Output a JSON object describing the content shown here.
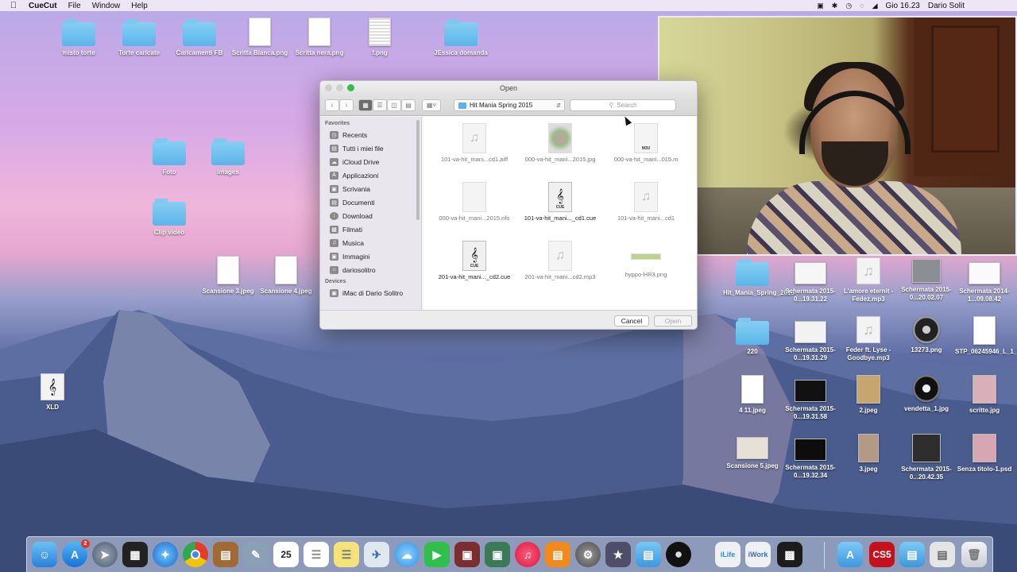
{
  "menubar": {
    "app_name": "CueCut",
    "menus": [
      "File",
      "Window",
      "Help"
    ],
    "clock": "Gio 16.23",
    "user": "Dario Solit"
  },
  "desktop": {
    "items": [
      {
        "label": "misto torte",
        "type": "folder"
      },
      {
        "label": "Torte caricate",
        "type": "folder"
      },
      {
        "label": "Caricamenti FB",
        "type": "folder"
      },
      {
        "label": "Scritta Bianca.png",
        "type": "doc"
      },
      {
        "label": "Scritta nera.png",
        "type": "doc"
      },
      {
        "label": "f.png",
        "type": "doc"
      },
      {
        "label": "JEssica domanda",
        "type": "folder"
      },
      {
        "label": "Foto",
        "type": "folder"
      },
      {
        "label": "Images",
        "type": "folder"
      },
      {
        "label": "Clip video",
        "type": "folder"
      },
      {
        "label": "Scansione 3.jpeg",
        "type": "doc"
      },
      {
        "label": "Scansione 4.jpeg",
        "type": "doc"
      },
      {
        "label": "XLD",
        "type": "app"
      },
      {
        "label": "Hit_Mania_Spring_2015",
        "type": "folder"
      },
      {
        "label": "Schermata 2015-0...19.31.22",
        "type": "thumb"
      },
      {
        "label": "L'amore eternit - Fedez.mp3",
        "type": "audio"
      },
      {
        "label": "Schermata 2015-0...20.02.07",
        "type": "thumb"
      },
      {
        "label": "Schermata 2014-1...09.08.42",
        "type": "thumb"
      },
      {
        "label": "220",
        "type": "folder"
      },
      {
        "label": "Schermata 2015-0...19.31.29",
        "type": "thumb"
      },
      {
        "label": "Feder ft. Lyse - Goodbye.mp3",
        "type": "audio"
      },
      {
        "label": "13273.png",
        "type": "thumb"
      },
      {
        "label": "STP_06245946_L_1_4_F...01V.pdf",
        "type": "doc"
      },
      {
        "label": "4 11.jpeg",
        "type": "doc"
      },
      {
        "label": "Schermata 2015-0...19.31.58",
        "type": "thumb"
      },
      {
        "label": "2.jpeg",
        "type": "thumb"
      },
      {
        "label": "vendetta_1.jpg",
        "type": "thumb"
      },
      {
        "label": "scritte.jpg",
        "type": "thumb"
      },
      {
        "label": "Scansione 5.jpeg",
        "type": "thumb"
      },
      {
        "label": "Schermata 2015-0...19.32.34",
        "type": "thumb"
      },
      {
        "label": "3.jpeg",
        "type": "thumb"
      },
      {
        "label": "Schermata 2015-0...20.42.35",
        "type": "thumb"
      },
      {
        "label": "Senza titolo-1.psd",
        "type": "thumb"
      }
    ]
  },
  "dialog": {
    "title": "Open",
    "location": "Hit Mania Spring 2015",
    "search_placeholder": "Search",
    "sidebar": {
      "favorites_header": "Favorites",
      "favorites": [
        "Recents",
        "Tutti i miei file",
        "iCloud Drive",
        "Applicazioni",
        "Scrivania",
        "Documenti",
        "Download",
        "Filmati",
        "Musica",
        "Immagini",
        "dariosolitro"
      ],
      "devices_header": "Devices",
      "devices": [
        "iMac di Dario Solitro"
      ]
    },
    "files": [
      {
        "name": "101-va-hit_mani...cd1.aiff",
        "kind": "audio",
        "enabled": false
      },
      {
        "name": "000-va-hit_mani...2015.jpg",
        "kind": "image",
        "enabled": false
      },
      {
        "name": "000-va-hit_mani...015.m",
        "kind": "m3u",
        "enabled": false
      },
      {
        "name": "000-va-hit_mani...2015.nfo",
        "kind": "doc",
        "enabled": false
      },
      {
        "name": "101-va-hit_mani..._cd1.cue",
        "kind": "cue",
        "enabled": true
      },
      {
        "name": "101-va-hit_mani...cd1",
        "kind": "audio",
        "enabled": false
      },
      {
        "name": "201-va-hit_mani..._cd2.cue",
        "kind": "cue",
        "enabled": true
      },
      {
        "name": "201-va-hit_mani...cd2.mp3",
        "kind": "audio",
        "enabled": false
      },
      {
        "name": "hyppo-HR3.png",
        "kind": "image",
        "enabled": false
      }
    ],
    "cue_badge": "CUE",
    "m3u_badge": "M3U",
    "cancel_label": "Cancel",
    "open_label": "Open"
  },
  "dock": {
    "badge_count": "2",
    "calendar_day": "25",
    "css_label": "CS5",
    "ilife_label": "iLife",
    "iwork_label": "iWork"
  },
  "colors": {
    "folder": "#5bb4e8",
    "traffic_close": "#d6d6d6",
    "traffic_max": "#2fc04a"
  }
}
